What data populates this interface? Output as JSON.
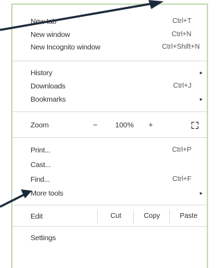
{
  "menu": {
    "new_tab": {
      "label": "New tab",
      "shortcut": "Ctrl+T"
    },
    "new_window": {
      "label": "New window",
      "shortcut": "Ctrl+N"
    },
    "new_incognito": {
      "label": "New Incognito window",
      "shortcut": "Ctrl+Shift+N"
    },
    "history": {
      "label": "History",
      "submenu_icon": "▸"
    },
    "downloads": {
      "label": "Downloads",
      "shortcut": "Ctrl+J"
    },
    "bookmarks": {
      "label": "Bookmarks",
      "submenu_icon": "▸"
    },
    "zoom": {
      "label": "Zoom",
      "minus": "−",
      "level": "100%",
      "plus": "+"
    },
    "print": {
      "label": "Print...",
      "shortcut": "Ctrl+P"
    },
    "cast": {
      "label": "Cast..."
    },
    "find": {
      "label": "Find...",
      "shortcut": "Ctrl+F"
    },
    "more_tools": {
      "label": "More tools",
      "submenu_icon": "▸"
    },
    "edit": {
      "label": "Edit",
      "cut": "Cut",
      "copy": "Copy",
      "paste": "Paste"
    },
    "settings": {
      "label": "Settings"
    }
  },
  "colors": {
    "frame_border": "#c4dcb6",
    "arrow": "#1a2a3a",
    "separator": "#dddddd",
    "text": "#333333"
  }
}
